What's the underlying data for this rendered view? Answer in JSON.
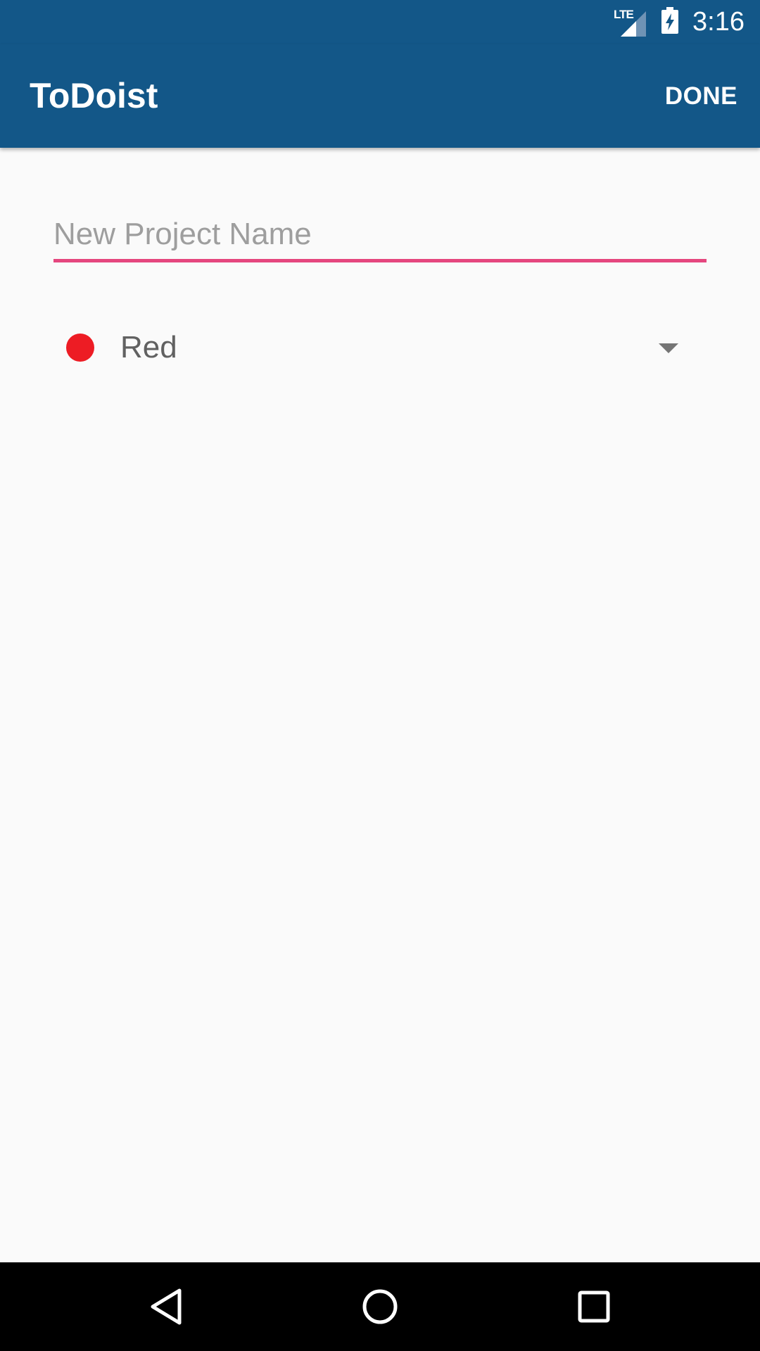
{
  "status_bar": {
    "network_label": "LTE",
    "time": "3:16"
  },
  "app_bar": {
    "title": "ToDoist",
    "done_label": "DONE"
  },
  "project_name": {
    "value": "",
    "placeholder": "New Project Name"
  },
  "color_selector": {
    "selected_label": "Red",
    "selected_color": "#ed1c24"
  },
  "colors": {
    "primary": "#135788",
    "accent": "#e5467e",
    "background": "#fafafa"
  },
  "nav_bar": {
    "icons": [
      "back-icon",
      "home-icon",
      "recents-icon"
    ]
  }
}
